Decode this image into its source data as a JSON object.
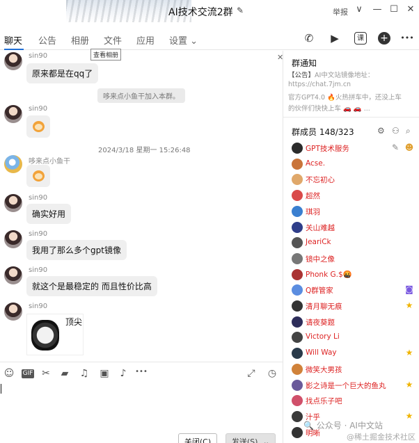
{
  "window": {
    "title": "AI技术交流2群",
    "report_label": "举报",
    "min": "—",
    "max": "☐",
    "close": "✕",
    "chevron": "∨",
    "edit": "✎"
  },
  "tabs": [
    {
      "label": "聊天"
    },
    {
      "label": "公告"
    },
    {
      "label": "相册"
    },
    {
      "label": "文件"
    },
    {
      "label": "应用"
    },
    {
      "label": "设置 ⌄"
    }
  ],
  "tooltip": "查看相册",
  "toolbar_icons": {
    "call": "✆",
    "video": "▶",
    "lesson": "课",
    "add": "+",
    "more": "•••"
  },
  "messages": [
    {
      "sender": "sin90",
      "text": "原来都是在qq了"
    },
    {
      "system": "哆来点小鱼干加入本群。"
    },
    {
      "sender": "sin90",
      "emoji": "dog-emoji"
    },
    {
      "timestamp": "2024/3/18 星期一 15:26:48"
    },
    {
      "sender": "哆来点小鱼干",
      "emoji": "dog-emoji"
    },
    {
      "sender": "sin90",
      "text": "确实好用"
    },
    {
      "sender": "sin90",
      "text": "我用了那么多个gpt镜像"
    },
    {
      "sender": "sin90",
      "text": "就这个是最稳定的 而且性价比高"
    },
    {
      "sender": "sin90",
      "sticker_text": "顶尖"
    }
  ],
  "composer": {
    "icons": [
      "☺",
      "GIF",
      "✂",
      "▰",
      "♫",
      "▣",
      "♪",
      "•••"
    ],
    "expand": "⤢",
    "history": "◷",
    "close_label": "关闭(C)",
    "send_label": "发送(S)",
    "send_dropdown": "⌄"
  },
  "notice": {
    "title": "群通知",
    "line1_tag": "【公告】",
    "line1": "AI中文站镜像地址：",
    "line2": "https://chat.7jm.cn",
    "line3": "官方GPT4.0 🔥火热拼车中，还没上车",
    "line4": "的伙伴们快快上车 🚗 🚗 ..."
  },
  "members": {
    "title": "群成员 148/323",
    "list": [
      {
        "name": "GPT技术服务",
        "badge": ""
      },
      {
        "name": "Acse.",
        "badge": ""
      },
      {
        "name": "不忘初心",
        "badge": ""
      },
      {
        "name": "超然",
        "badge": ""
      },
      {
        "name": "琪羽",
        "badge": ""
      },
      {
        "name": "关山难越",
        "badge": ""
      },
      {
        "name": "JeariCk",
        "badge": ""
      },
      {
        "name": "镜中之像",
        "badge": ""
      },
      {
        "name": "Phonk G.$🤬",
        "badge": ""
      },
      {
        "name": "Q群管家",
        "badge": "bot"
      },
      {
        "name": "清月聊无痕",
        "badge": "star"
      },
      {
        "name": "请夜葵题",
        "badge": ""
      },
      {
        "name": "Victory Li",
        "badge": ""
      },
      {
        "name": "Will Way",
        "badge": "star"
      },
      {
        "name": "微笑大男孩",
        "badge": ""
      },
      {
        "name": "影之诗是一个巨大的鱼丸",
        "badge": "star"
      },
      {
        "name": "找点乐子吧",
        "badge": ""
      },
      {
        "name": "汁乎",
        "badge": "star"
      },
      {
        "name": "明晰",
        "badge": ""
      }
    ]
  },
  "watermark": "🔍 公众号 · AI中文站",
  "watermark2": "@稀土掘金技术社区",
  "colors": {
    "accent": "#1f6fd6",
    "member_name": "#d22222"
  }
}
